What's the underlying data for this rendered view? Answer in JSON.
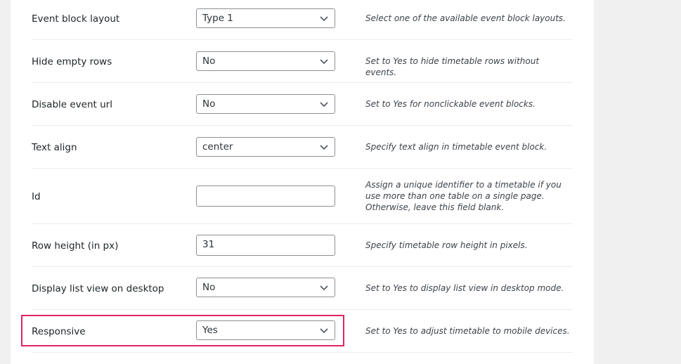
{
  "settings": [
    {
      "label": "Event block layout",
      "type": "select",
      "value": "Type 1",
      "description": "Select one of the available event block layouts."
    },
    {
      "label": "Hide empty rows",
      "type": "select",
      "value": "No",
      "description": "Set to Yes to hide timetable rows without events."
    },
    {
      "label": "Disable event url",
      "type": "select",
      "value": "No",
      "description": "Set to Yes for nonclickable event blocks."
    },
    {
      "label": "Text align",
      "type": "select",
      "value": "center",
      "description": "Specify text align in timetable event block."
    },
    {
      "label": "Id",
      "type": "text",
      "value": "",
      "description": "Assign a unique identifier to a timetable if you use more than one table on a single page. Otherwise, leave this field blank."
    },
    {
      "label": "Row height (in px)",
      "type": "text",
      "value": "31",
      "description": "Specify timetable row height in pixels."
    },
    {
      "label": "Display list view on desktop",
      "type": "select",
      "value": "No",
      "description": "Set to Yes to display list view in desktop mode."
    },
    {
      "label": "Responsive",
      "type": "select",
      "value": "Yes",
      "description": "Set to Yes to adjust timetable to mobile devices.",
      "highlighted": true
    }
  ],
  "colors": {
    "highlight_border": "#e0245e",
    "page_background": "#f0f0f1",
    "panel_background": "#ffffff"
  }
}
